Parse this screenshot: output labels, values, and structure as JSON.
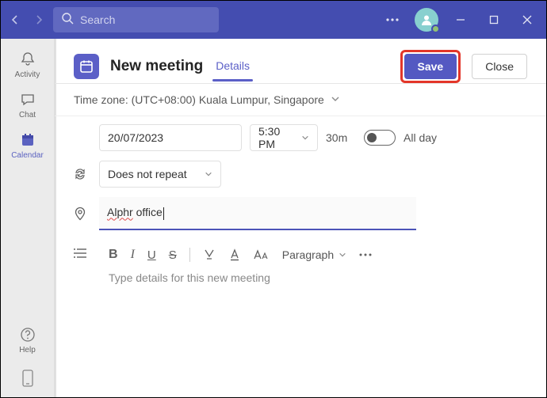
{
  "titlebar": {
    "search_placeholder": "Search"
  },
  "rail": {
    "activity": "Activity",
    "chat": "Chat",
    "calendar": "Calendar",
    "help": "Help"
  },
  "header": {
    "title": "New meeting",
    "tab_details": "Details",
    "save": "Save",
    "close": "Close"
  },
  "timezone": {
    "label": "Time zone: (UTC+08:00) Kuala Lumpur, Singapore"
  },
  "form": {
    "date": "20/07/2023",
    "time": "5:30 PM",
    "duration": "30m",
    "allday": "All day",
    "repeat": "Does not repeat",
    "location_pre": "Alphr",
    "location_post": " office",
    "paragraph": "Paragraph",
    "details_placeholder": "Type details for this new meeting"
  }
}
